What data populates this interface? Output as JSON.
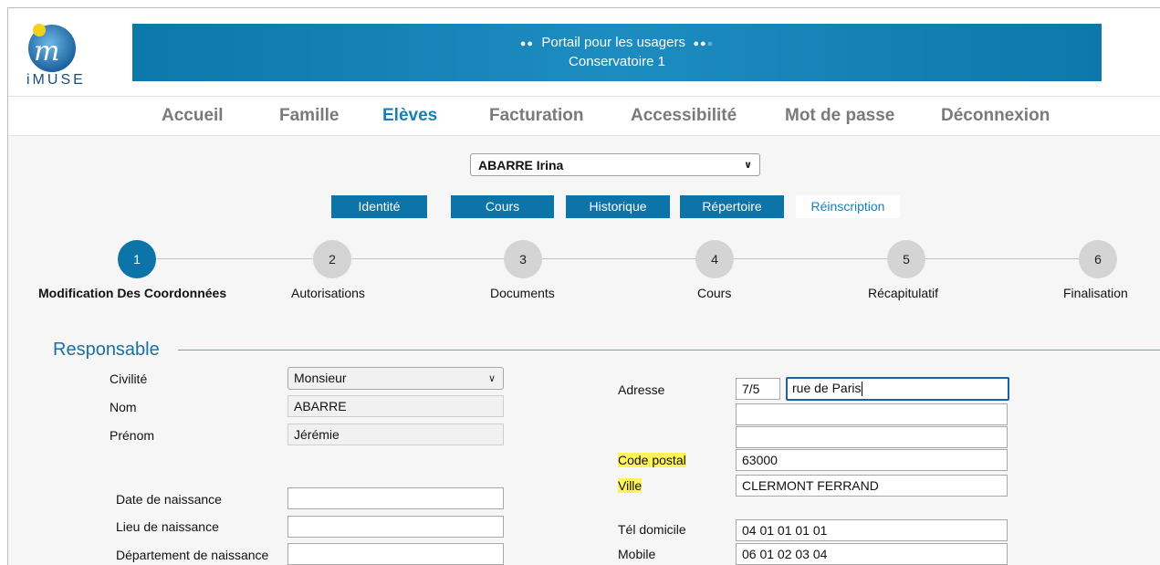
{
  "brand": {
    "logo_text": "iMUSE"
  },
  "banner": {
    "line1": "Portail pour les usagers",
    "line2": "Conservatoire 1"
  },
  "nav": {
    "items": [
      {
        "label": "Accueil"
      },
      {
        "label": "Famille"
      },
      {
        "label": "Elèves",
        "active": true
      },
      {
        "label": "Facturation"
      },
      {
        "label": "Accessibilité"
      },
      {
        "label": "Mot de passe"
      },
      {
        "label": "Déconnexion"
      }
    ]
  },
  "student_selector": {
    "selected": "ABARRE Irina"
  },
  "tabs": [
    {
      "label": "Identité"
    },
    {
      "label": "Cours"
    },
    {
      "label": "Historique"
    },
    {
      "label": "Répertoire"
    },
    {
      "label": "Réinscription",
      "active": true
    }
  ],
  "steps": [
    {
      "number": "1",
      "label": "Modification Des Coordonnées",
      "active": true
    },
    {
      "number": "2",
      "label": "Autorisations"
    },
    {
      "number": "3",
      "label": "Documents"
    },
    {
      "number": "4",
      "label": "Cours"
    },
    {
      "number": "5",
      "label": "Récapitulatif"
    },
    {
      "number": "6",
      "label": "Finalisation"
    }
  ],
  "section": {
    "title": "Responsable"
  },
  "form": {
    "civilite": {
      "label": "Civilité",
      "value": "Monsieur"
    },
    "nom": {
      "label": "Nom",
      "value": "ABARRE"
    },
    "prenom": {
      "label": "Prénom",
      "value": "Jérémie"
    },
    "date_naissance": {
      "label": "Date de naissance",
      "value": ""
    },
    "lieu_naissance": {
      "label": "Lieu de naissance",
      "value": ""
    },
    "departement_naissance": {
      "label": "Département de naissance",
      "value": ""
    },
    "adresse": {
      "label": "Adresse",
      "numero": "7/5",
      "rue": "rue de Paris",
      "ligne2": "",
      "ligne3": ""
    },
    "code_postal": {
      "label": "Code postal",
      "value": "63000"
    },
    "ville": {
      "label": "Ville",
      "value": "CLERMONT FERRAND"
    },
    "tel_domicile": {
      "label": "Tél domicile",
      "value": "04 01 01 01 01"
    },
    "mobile": {
      "label": "Mobile",
      "value": "06 01 02 03 04"
    }
  },
  "colors": {
    "primary": "#0c74a9",
    "active_nav": "#1a7fb5",
    "highlight": "#fff35a"
  }
}
